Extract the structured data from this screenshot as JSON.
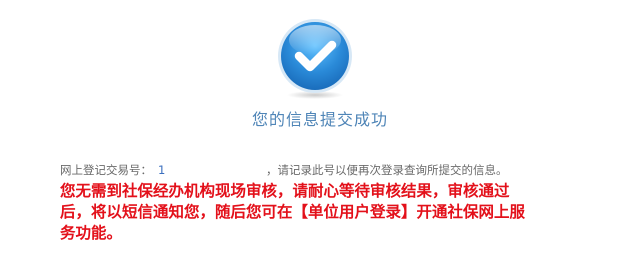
{
  "status": {
    "icon": "check-circle-icon",
    "accent_color": "#2a8ad8",
    "title": "您的信息提交成功"
  },
  "registration": {
    "label": "网上登记交易号：",
    "value": "1",
    "hint": "，请记录此号以便再次登录查询所提交的信息。"
  },
  "notice": {
    "text": "您无需到社保经办机构现场审核，请耐心等待审核结果，审核通过后，将以短信通知您，随后您可在【单位用户登录】开通社保网上服务功能。",
    "color": "#e3101a"
  }
}
